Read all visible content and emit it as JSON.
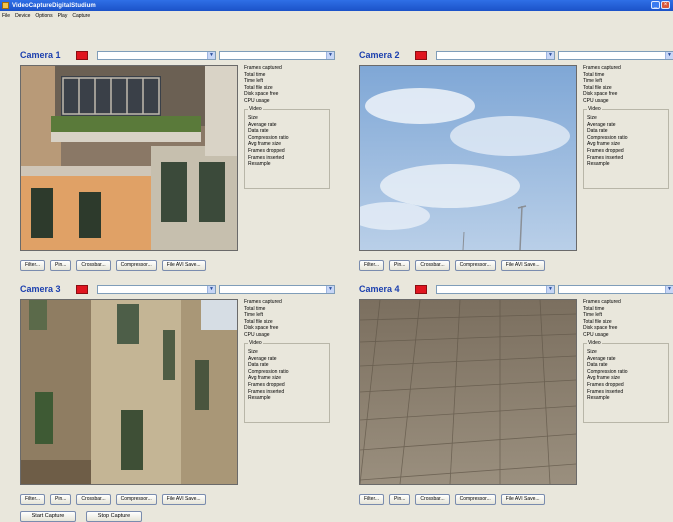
{
  "window": {
    "title": "VideoCaptureDigitalStudium"
  },
  "menu": [
    "File",
    "Device",
    "Options",
    "Play",
    "Capture"
  ],
  "stat_labels": [
    "Frames captured",
    "Total time",
    "Time left",
    "Total file size",
    "Disk space free",
    "CPU usage"
  ],
  "video_group": {
    "title": "Video",
    "items": [
      "Size",
      "Average rate",
      "Data rate",
      "Compression ratio",
      "Avg frame size",
      "Frames dropped",
      "Frames inserted",
      "Resample"
    ]
  },
  "buttons": [
    "Filter...",
    "Pin...",
    "Crossbar...",
    "Compressor...",
    "File AVI Save..."
  ],
  "cameras": [
    {
      "label": "Camera 1",
      "indicator_color": "#e0151f"
    },
    {
      "label": "Camera 2",
      "indicator_color": "#e0151f"
    },
    {
      "label": "Camera 3",
      "indicator_color": "#e0151f"
    },
    {
      "label": "Camera 4",
      "indicator_color": "#e0151f"
    }
  ],
  "bottom_buttons": {
    "start": "Start Capture",
    "stop": "Stop Capture"
  }
}
